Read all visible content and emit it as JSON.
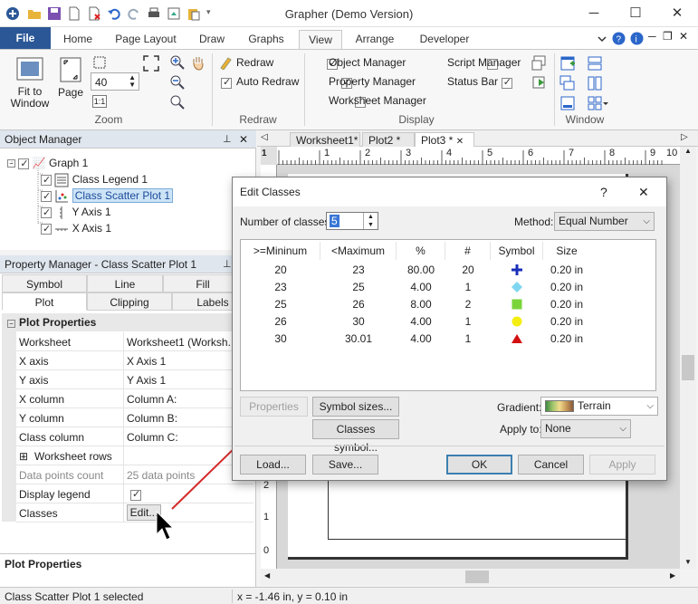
{
  "window": {
    "title": "Grapher (Demo Version)",
    "minimize": "─",
    "maximize": "☐",
    "close": "✕"
  },
  "ribbon": {
    "tabs": [
      "File",
      "Home",
      "Page Layout",
      "Draw",
      "Graphs",
      "View",
      "Arrange",
      "Developer"
    ],
    "zoom_group": {
      "fit_to_window": "Fit to\nWindow",
      "page": "Page",
      "zoom_value": "40",
      "one_to_one": "1:1",
      "label": "Zoom"
    },
    "redraw_group": {
      "redraw": "Redraw",
      "auto_redraw": "Auto Redraw",
      "label": "Redraw"
    },
    "display_group": {
      "object_manager": "Object Manager",
      "property_manager": "Property Manager",
      "worksheet_manager": "Worksheet Manager",
      "script_manager": "Script Manager",
      "status_bar": "Status Bar",
      "label": "Display"
    },
    "window_group": {
      "label": "Window"
    }
  },
  "object_manager": {
    "title": "Object Manager",
    "items": [
      {
        "label": "Graph 1"
      },
      {
        "label": "Class Legend 1"
      },
      {
        "label": "Class Scatter Plot 1"
      },
      {
        "label": "Y Axis 1"
      },
      {
        "label": "X Axis 1"
      }
    ]
  },
  "property_manager": {
    "title": "Property Manager - Class Scatter Plot 1",
    "tabs_row1": [
      "Symbol",
      "Line",
      "Fill"
    ],
    "tabs_row2": [
      "Plot",
      "Clipping",
      "Labels"
    ],
    "section": "Plot Properties",
    "rows": [
      {
        "key": "Worksheet",
        "value": "Worksheet1 (Worksh..."
      },
      {
        "key": "X axis",
        "value": "X Axis 1"
      },
      {
        "key": "Y axis",
        "value": "Y Axis 1"
      },
      {
        "key": "X column",
        "value": "Column A:"
      },
      {
        "key": "Y column",
        "value": "Column B:"
      },
      {
        "key": "Class column",
        "value": "Column C:"
      },
      {
        "key": "Worksheet rows",
        "value": ""
      },
      {
        "key": "Data points count",
        "value": "25 data points"
      },
      {
        "key": "Display legend",
        "value": ""
      },
      {
        "key": "Classes",
        "value": ""
      }
    ],
    "edit_button": "Edit...",
    "footer": "Plot Properties"
  },
  "plot": {
    "tabs": [
      "Worksheet1*",
      "Plot2 *",
      "Plot3 *"
    ],
    "ruler_ticks": [
      "1",
      "1",
      "2",
      "3",
      "4",
      "5",
      "6",
      "7",
      "8",
      "9",
      "10"
    ],
    "vruler_ticks": [
      "2",
      "1",
      "0"
    ]
  },
  "dialog": {
    "title": "Edit Classes",
    "help": "?",
    "close": "✕",
    "num_classes_label": "Number of classes:",
    "num_classes_value": "5",
    "method_label": "Method:",
    "method_value": "Equal Number",
    "columns": [
      ">=Mininum",
      "<Maximum",
      "%",
      "#",
      "Symbol",
      "Size"
    ],
    "rows": [
      {
        "min": "20",
        "max": "23",
        "pct": "80.00",
        "count": "20",
        "symbol": "plus",
        "color": "#1a2fb8",
        "size": "0.20 in"
      },
      {
        "min": "23",
        "max": "25",
        "pct": "4.00",
        "count": "1",
        "symbol": "diamond",
        "color": "#7fd6f0",
        "size": "0.20 in"
      },
      {
        "min": "25",
        "max": "26",
        "pct": "8.00",
        "count": "2",
        "symbol": "square",
        "color": "#7ad43a",
        "size": "0.20 in"
      },
      {
        "min": "26",
        "max": "30",
        "pct": "4.00",
        "count": "1",
        "symbol": "circle",
        "color": "#f4ee10",
        "size": "0.20 in"
      },
      {
        "min": "30",
        "max": "30.01",
        "pct": "4.00",
        "count": "1",
        "symbol": "triangle",
        "color": "#d31010",
        "size": "0.20 in"
      }
    ],
    "properties_btn": "Properties",
    "symbol_sizes_btn": "Symbol sizes...",
    "classes_symbol_btn": "Classes symbol...",
    "gradient_label": "Gradient:",
    "gradient_value": "Terrain",
    "apply_to_label": "Apply to:",
    "apply_to_value": "None",
    "load_btn": "Load...",
    "save_btn": "Save...",
    "ok_btn": "OK",
    "cancel_btn": "Cancel",
    "apply_btn": "Apply"
  },
  "status": {
    "selection": "Class Scatter Plot 1 selected",
    "coords": "x = -1.46 in, y = 0.10 in"
  }
}
